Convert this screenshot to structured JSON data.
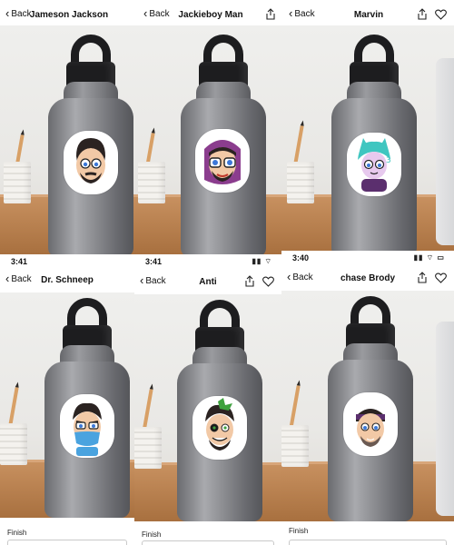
{
  "panels": [
    {
      "title": "Jameson Jackson",
      "back_label": "Back",
      "status_time": "",
      "finish_label": ""
    },
    {
      "title": "Jackieboy Man",
      "back_label": "Back",
      "status_time": "",
      "finish_label": ""
    },
    {
      "title": "Marvin",
      "back_label": "Back",
      "status_time": "",
      "finish_label": ""
    },
    {
      "title": "Dr. Schneep",
      "back_label": "Back",
      "status_time": "3:41",
      "finish_label": "Finish"
    },
    {
      "title": "Anti",
      "back_label": "Back",
      "status_time": "3:41",
      "finish_label": "Finish"
    },
    {
      "title": "chase Brody",
      "back_label": "Back",
      "status_time": "3:40",
      "finish_label": "Finish"
    }
  ],
  "colors": {
    "sticker_outline": "#ffffff",
    "hair_dark": "#2b2321",
    "skin": "#f2c9a6",
    "eye_blue": "#3c78d8",
    "purple_hood": "#8b3d8e",
    "teal_hair": "#3fc6c0",
    "mask_blue": "#4aa3df",
    "green_hair": "#3ea13e"
  },
  "icons": {
    "back": "chevron-left-icon",
    "share": "share-icon",
    "favorite": "heart-icon",
    "signal": "signal-icon",
    "wifi": "wifi-icon",
    "battery": "battery-icon"
  }
}
